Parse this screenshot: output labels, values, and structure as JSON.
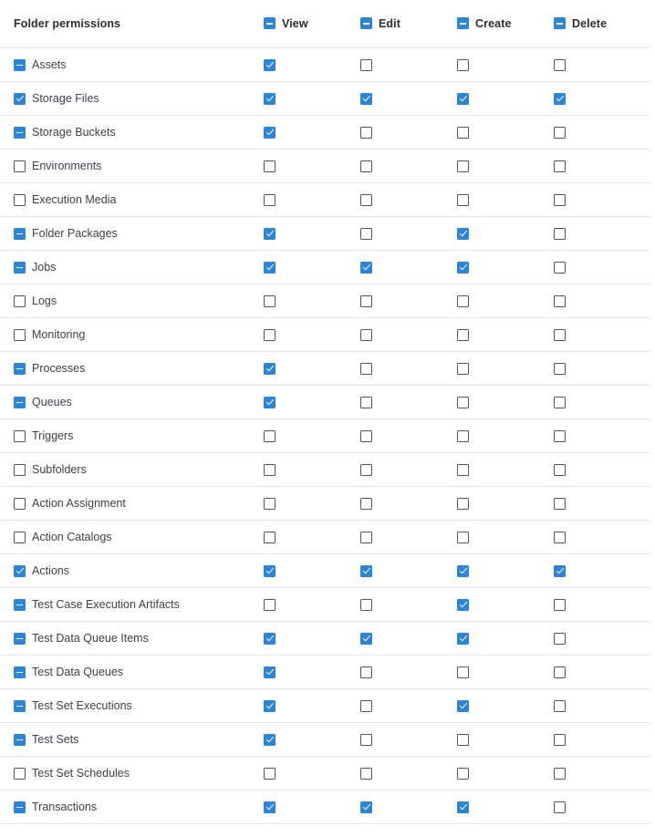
{
  "header": {
    "title": "Folder permissions",
    "columns": [
      "View",
      "Edit",
      "Create",
      "Delete"
    ],
    "column_states": [
      "indeterminate",
      "indeterminate",
      "indeterminate",
      "indeterminate"
    ]
  },
  "rows": [
    {
      "name": "Assets",
      "state": "indeterminate",
      "perms": [
        true,
        false,
        false,
        false
      ]
    },
    {
      "name": "Storage Files",
      "state": "checked",
      "perms": [
        true,
        true,
        true,
        true
      ]
    },
    {
      "name": "Storage Buckets",
      "state": "indeterminate",
      "perms": [
        true,
        false,
        false,
        false
      ]
    },
    {
      "name": "Environments",
      "state": "unchecked",
      "perms": [
        false,
        false,
        false,
        false
      ]
    },
    {
      "name": "Execution Media",
      "state": "unchecked",
      "perms": [
        false,
        false,
        false,
        false
      ]
    },
    {
      "name": "Folder Packages",
      "state": "indeterminate",
      "perms": [
        true,
        false,
        true,
        false
      ]
    },
    {
      "name": "Jobs",
      "state": "indeterminate",
      "perms": [
        true,
        true,
        true,
        false
      ]
    },
    {
      "name": "Logs",
      "state": "unchecked",
      "perms": [
        false,
        false,
        false,
        false
      ]
    },
    {
      "name": "Monitoring",
      "state": "unchecked",
      "perms": [
        false,
        false,
        false,
        false
      ]
    },
    {
      "name": "Processes",
      "state": "indeterminate",
      "perms": [
        true,
        false,
        false,
        false
      ]
    },
    {
      "name": "Queues",
      "state": "indeterminate",
      "perms": [
        true,
        false,
        false,
        false
      ]
    },
    {
      "name": "Triggers",
      "state": "unchecked",
      "perms": [
        false,
        false,
        false,
        false
      ]
    },
    {
      "name": "Subfolders",
      "state": "unchecked",
      "perms": [
        false,
        false,
        false,
        false
      ]
    },
    {
      "name": "Action Assignment",
      "state": "unchecked",
      "perms": [
        false,
        false,
        false,
        false
      ]
    },
    {
      "name": "Action Catalogs",
      "state": "unchecked",
      "perms": [
        false,
        false,
        false,
        false
      ]
    },
    {
      "name": "Actions",
      "state": "checked",
      "perms": [
        true,
        true,
        true,
        true
      ]
    },
    {
      "name": "Test Case Execution Artifacts",
      "state": "indeterminate",
      "perms": [
        false,
        false,
        true,
        false
      ]
    },
    {
      "name": "Test Data Queue Items",
      "state": "indeterminate",
      "perms": [
        true,
        true,
        true,
        false
      ]
    },
    {
      "name": "Test Data Queues",
      "state": "indeterminate",
      "perms": [
        true,
        false,
        false,
        false
      ]
    },
    {
      "name": "Test Set Executions",
      "state": "indeterminate",
      "perms": [
        true,
        false,
        true,
        false
      ]
    },
    {
      "name": "Test Sets",
      "state": "indeterminate",
      "perms": [
        true,
        false,
        false,
        false
      ]
    },
    {
      "name": "Test Set Schedules",
      "state": "unchecked",
      "perms": [
        false,
        false,
        false,
        false
      ]
    },
    {
      "name": "Transactions",
      "state": "indeterminate",
      "perms": [
        true,
        true,
        true,
        false
      ]
    }
  ],
  "colors": {
    "accent": "#2d85d9",
    "border": "#e6e6e6",
    "unchecked_border": "#525659"
  }
}
